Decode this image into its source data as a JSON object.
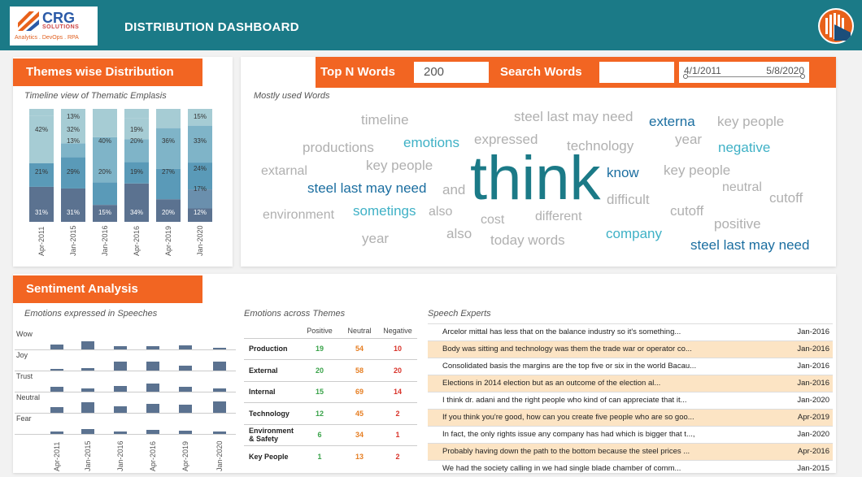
{
  "header": {
    "logo_text": "CRG",
    "logo_sub": "SOLUTIONS",
    "logo_tag": "Analytics . DevOps . RPA",
    "title": "DISTRIBUTION DASHBOARD"
  },
  "themes": {
    "title": "Themes wise Distribution",
    "subtitle": "Timeline view of Thematic Emplasis"
  },
  "chart_data": {
    "type": "bar",
    "stacked": true,
    "categories": [
      "Apr-2011",
      "Jan-2015",
      "Jan-2016",
      "Apr-2016",
      "Apr-2019",
      "Jan-2020"
    ],
    "colors": [
      "#5b7290",
      "#6a8fad",
      "#5a9ab8",
      "#7fb4c8",
      "#a6ccd4"
    ],
    "series": [
      {
        "values": [
          31,
          31,
          15,
          34,
          20,
          12
        ]
      },
      {
        "values": [
          0,
          0,
          0,
          0,
          0,
          17
        ]
      },
      {
        "values": [
          21,
          29,
          20,
          19,
          27,
          24
        ]
      },
      {
        "values": [
          0,
          13,
          40,
          20,
          36,
          33
        ]
      },
      {
        "values": [
          42,
          32,
          0,
          19,
          0,
          15
        ]
      }
    ],
    "segment_labels": [
      [
        "31%",
        "31%",
        "15%",
        "34%",
        "20%",
        "12%"
      ],
      [
        "",
        "",
        "",
        "",
        "",
        "17%"
      ],
      [
        "21%",
        "29%",
        "20%",
        "19%",
        "27%",
        "24%"
      ],
      [
        "",
        "13%",
        "40%",
        "20%",
        "36%",
        "33%"
      ],
      [
        "42%",
        "32%",
        "",
        "19%",
        "",
        ""
      ],
      [
        "",
        "13%",
        "",
        "",
        "",
        "15%"
      ]
    ]
  },
  "filters": {
    "top_n_label": "Top N Words",
    "top_n_value": "200",
    "search_label": "Search Words",
    "search_value": "",
    "date_start": "4/1/2011",
    "date_end": "5/8/2020"
  },
  "wordcloud": {
    "subtitle": "Mostly used Words",
    "words": [
      {
        "text": "timeline",
        "color": "#b0b0b0",
        "size": 17
      },
      {
        "text": "steel last may need",
        "color": "#b0b0b0",
        "size": 17
      },
      {
        "text": "externa",
        "color": "#1b6ea0",
        "size": 17
      },
      {
        "text": "key people",
        "color": "#b0b0b0",
        "size": 17
      },
      {
        "text": "productions",
        "color": "#b0b0b0",
        "size": 17
      },
      {
        "text": "emotions",
        "color": "#3fb1c6",
        "size": 17
      },
      {
        "text": "expressed",
        "color": "#b0b0b0",
        "size": 17
      },
      {
        "text": "technology",
        "color": "#b0b0b0",
        "size": 17
      },
      {
        "text": "year",
        "color": "#b0b0b0",
        "size": 17
      },
      {
        "text": "negative",
        "color": "#3fb1c6",
        "size": 17
      },
      {
        "text": "extarnal",
        "color": "#b0b0b0",
        "size": 16
      },
      {
        "text": "key people",
        "color": "#b0b0b0",
        "size": 17
      },
      {
        "text": "know",
        "color": "#1b6ea0",
        "size": 17
      },
      {
        "text": "key people",
        "color": "#b0b0b0",
        "size": 17
      },
      {
        "text": "steel last may need",
        "color": "#1b6ea0",
        "size": 17
      },
      {
        "text": "and",
        "color": "#b0b0b0",
        "size": 17
      },
      {
        "text": "think",
        "color": "#1b7a87",
        "size": 76
      },
      {
        "text": "neutral",
        "color": "#b0b0b0",
        "size": 16
      },
      {
        "text": "cutoff",
        "color": "#b0b0b0",
        "size": 17
      },
      {
        "text": "difficult",
        "color": "#b0b0b0",
        "size": 17
      },
      {
        "text": "environment",
        "color": "#b0b0b0",
        "size": 16
      },
      {
        "text": "sometings",
        "color": "#3fb1c6",
        "size": 17
      },
      {
        "text": "also",
        "color": "#b0b0b0",
        "size": 16
      },
      {
        "text": "cost",
        "color": "#b0b0b0",
        "size": 16
      },
      {
        "text": "different",
        "color": "#b0b0b0",
        "size": 16
      },
      {
        "text": "cutoff",
        "color": "#b0b0b0",
        "size": 17
      },
      {
        "text": "positive",
        "color": "#b0b0b0",
        "size": 17
      },
      {
        "text": "year",
        "color": "#b0b0b0",
        "size": 17
      },
      {
        "text": "also",
        "color": "#b0b0b0",
        "size": 17
      },
      {
        "text": "today words",
        "color": "#b0b0b0",
        "size": 17
      },
      {
        "text": "company",
        "color": "#3fb1c6",
        "size": 17
      },
      {
        "text": "steel last may need",
        "color": "#1b6ea0",
        "size": 17
      }
    ]
  },
  "sentiment": {
    "title": "Sentiment Analysis",
    "subtitle": "Emotions expressed in Speeches",
    "emotions": [
      "Wow",
      "Joy",
      "Trust",
      "Neutral",
      "Fear"
    ],
    "periods": [
      "Apr-2011",
      "Jan-2015",
      "Jan-2016",
      "Apr-2016",
      "Apr-2019",
      "Jan-2020"
    ],
    "values": [
      [
        0.4,
        0.7,
        0.3,
        0.3,
        0.35,
        0.1
      ],
      [
        0.1,
        0.2,
        0.8,
        0.8,
        0.4,
        0.8
      ],
      [
        0.4,
        0.3,
        0.5,
        0.7,
        0.4,
        0.3
      ],
      [
        0.5,
        0.9,
        0.6,
        0.8,
        0.7,
        1.0
      ],
      [
        0.2,
        0.4,
        0.2,
        0.35,
        0.3,
        0.2
      ]
    ]
  },
  "themes_table": {
    "subtitle": "Emotions across Themes",
    "headers": [
      "Positive",
      "Neutral",
      "Negative"
    ],
    "rows": [
      {
        "name": "Production",
        "pos": "19",
        "neu": "54",
        "neg": "10"
      },
      {
        "name": "External",
        "pos": "20",
        "neu": "58",
        "neg": "20"
      },
      {
        "name": "Internal",
        "pos": "15",
        "neu": "69",
        "neg": "14"
      },
      {
        "name": "Technology",
        "pos": "12",
        "neu": "45",
        "neg": "2"
      },
      {
        "name": "Environment & Safety",
        "pos": "6",
        "neu": "34",
        "neg": "1"
      },
      {
        "name": "Key People",
        "pos": "1",
        "neu": "13",
        "neg": "2"
      }
    ]
  },
  "speech": {
    "subtitle": "Speech Experts",
    "rows": [
      {
        "text": "Arcelor mittal has less that on the balance industry so it's something...",
        "date": "Jan-2016"
      },
      {
        "text": "Body was sitting and technology was them the trade war or operator co...",
        "date": "Jan-2016"
      },
      {
        "text": "Consolidated basis the margins are the top five or six in the world Bacau...",
        "date": "Jan-2016"
      },
      {
        "text": "Elections in 2014 election but as an outcome of the election al...",
        "date": "Jan-2016"
      },
      {
        "text": "I think dr. adani and the right people who kind of can appreciate that it...",
        "date": "Jan-2020"
      },
      {
        "text": "If you think  you're good, how can you create five people who are so goo...",
        "date": "Apr-2019"
      },
      {
        "text": "In fact, the only rights issue any company has had which is bigger that t...,",
        "date": "Jan-2020"
      },
      {
        "text": "Probably having down the path to the bottom because the steel prices ...",
        "date": "Apr-2016"
      },
      {
        "text": "We had the society calling in we had single blade chamber of comm...",
        "date": "Jan-2015"
      }
    ]
  }
}
